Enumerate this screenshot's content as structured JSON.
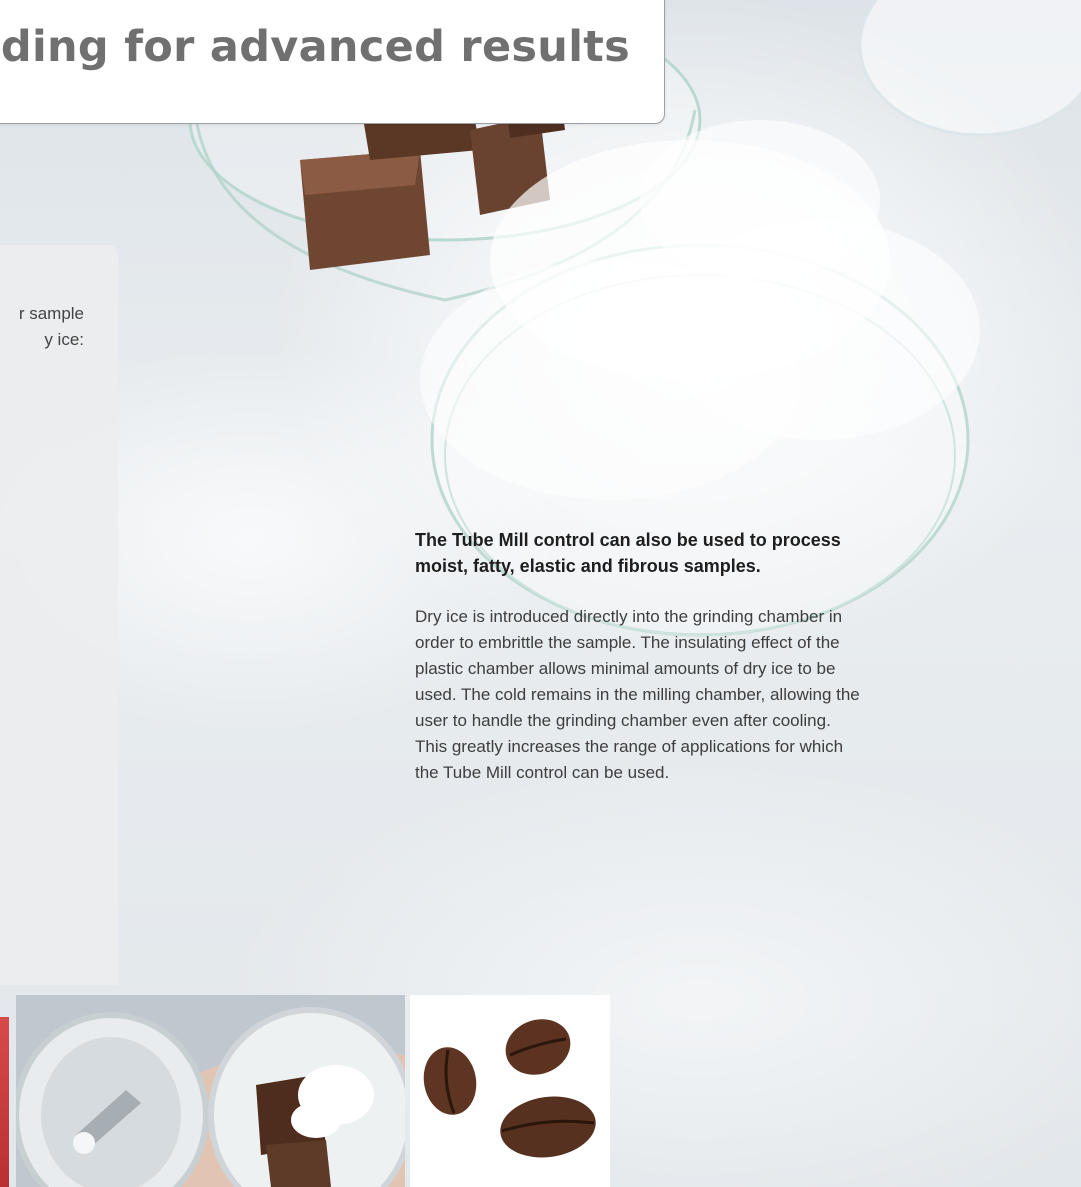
{
  "header": {
    "title_fragment": "nding for advanced results"
  },
  "side_panel": {
    "lines": [
      "r sample",
      "y ice:"
    ]
  },
  "main": {
    "title_lines": [
      "The Tube Mill control can also be used to process",
      "moist, fatty, elastic and fibrous samples."
    ],
    "paragraph_lines": [
      "Dry ice is introduced directly into the grinding chamber in",
      "order to embrittle the sample. The insulating effect of the",
      "plastic chamber allows minimal amounts of dry ice to be",
      "used. The cold remains in the milling chamber, allowing the",
      "user to handle the grinding chamber even after cooling.",
      "This greatly increases the range of applications for which",
      "the Tube Mill control can be used."
    ]
  },
  "colors": {
    "heading_gray": "#707070",
    "body_text": "#3e3e3e",
    "accent_red": "#c83b3b"
  }
}
